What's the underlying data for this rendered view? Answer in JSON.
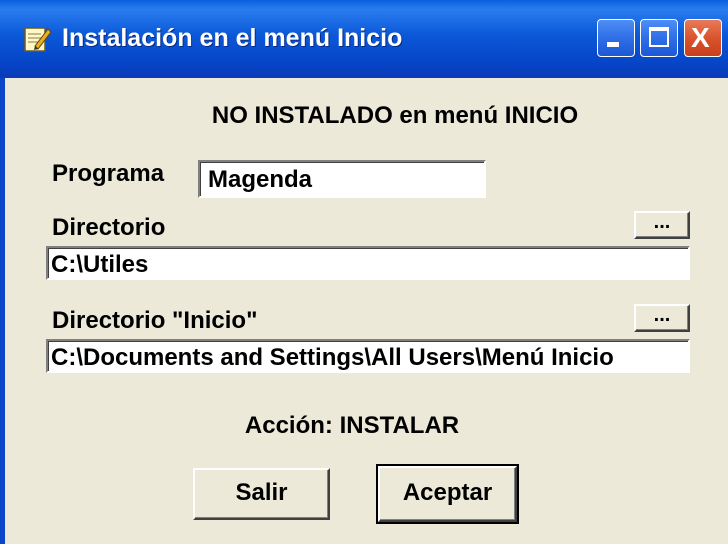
{
  "window": {
    "title": "Instalación en el menú Inicio",
    "icon": "notepad-pencil-icon",
    "controls": {
      "minimize_icon": "minimize-icon",
      "maximize_icon": "maximize-icon",
      "close_icon": "close-icon",
      "close_glyph": "X"
    }
  },
  "status_text": "NO INSTALADO en menú INICIO",
  "programa": {
    "label": "Programa",
    "value": "Magenda"
  },
  "directorio": {
    "label": "Directorio",
    "value": "C:\\Utiles",
    "browse_label": "..."
  },
  "directorio_inicio": {
    "label": "Directorio \"Inicio\"",
    "value": "C:\\Documents and Settings\\All Users\\Menú Inicio",
    "browse_label": "..."
  },
  "accion_text": "Acción: INSTALAR",
  "buttons": {
    "salir": "Salir",
    "aceptar": "Aceptar"
  },
  "colors": {
    "titlebar": "#0a5fdc",
    "dialog_bg": "#ece9d8",
    "close_button": "#d8542c"
  }
}
